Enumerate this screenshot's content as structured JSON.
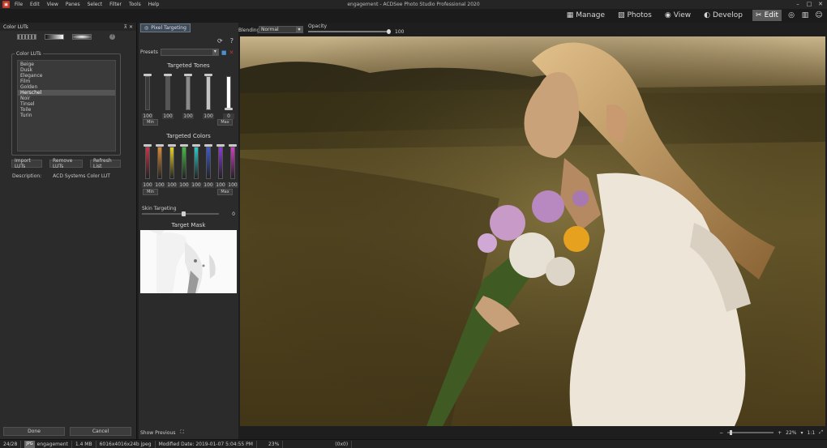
{
  "window": {
    "title": "engagement - ACDSee Photo Studio Professional 2020",
    "menus": [
      "File",
      "Edit",
      "View",
      "Panes",
      "Select",
      "Filter",
      "Tools",
      "Help"
    ]
  },
  "modes": [
    {
      "label": "Manage",
      "icon": "grid-icon"
    },
    {
      "label": "Photos",
      "icon": "photos-icon"
    },
    {
      "label": "View",
      "icon": "eye-icon"
    },
    {
      "label": "Develop",
      "icon": "develop-icon"
    },
    {
      "label": "Edit",
      "icon": "edit-icon",
      "active": true
    }
  ],
  "left_panel": {
    "header": "Color LUTs",
    "group_title": "Color LUTs",
    "luts": [
      "Beige",
      "Dusk",
      "Elegance",
      "Film",
      "Golden",
      "Herschel",
      "Noir",
      "Tinsel",
      "Toile",
      "Turin"
    ],
    "selected_lut": "Herschel",
    "buttons": {
      "import": "Import LUTs",
      "remove": "Remove LUTs",
      "refresh": "Refresh List"
    },
    "description_label": "Description:",
    "description_value": "ACD Systems Color LUT",
    "done": "Done",
    "cancel": "Cancel"
  },
  "mid_panel": {
    "pixel_targeting": "Pixel Targeting",
    "presets_label": "Presets",
    "targeted_tones_title": "Targeted Tones",
    "tones": [
      {
        "value": "100",
        "level": 1.0,
        "color": "#3a3a3a"
      },
      {
        "value": "100",
        "level": 1.0,
        "color": "#555555"
      },
      {
        "value": "100",
        "level": 1.0,
        "color": "#8a8a8a"
      },
      {
        "value": "100",
        "level": 1.0,
        "color": "#c4c4c4"
      },
      {
        "value": "0",
        "level": 0.0,
        "color": "#ffffff"
      }
    ],
    "min_label": "Min",
    "max_label": "Max",
    "targeted_colors_title": "Targeted Colors",
    "colors": [
      {
        "value": "100",
        "color": "#c8344a"
      },
      {
        "value": "100",
        "color": "#e08a2a"
      },
      {
        "value": "100",
        "color": "#e6d12a"
      },
      {
        "value": "100",
        "color": "#3fbf3f"
      },
      {
        "value": "100",
        "color": "#2fc9c9"
      },
      {
        "value": "100",
        "color": "#3a5ad6"
      },
      {
        "value": "100",
        "color": "#8a3ad6"
      },
      {
        "value": "100",
        "color": "#d63ac8"
      }
    ],
    "skin_label": "Skin Targeting",
    "skin_value": "0",
    "skin_level": 0.5,
    "mask_title": "Target Mask",
    "show_previous": "Show Previous"
  },
  "image_toolbar": {
    "blending_label": "Blending:",
    "blending_value": "Normal",
    "opacity_label": "Opacity",
    "opacity_value": "100"
  },
  "zoom": {
    "value": "22%",
    "ratio": "1:1"
  },
  "status": {
    "index": "24/28",
    "type": "JPG",
    "name": "engagement",
    "size": "1.4 MB",
    "dims": "6016x4016x24b jpeg",
    "modified": "Modified Date: 2019-01-07 5:04:55 PM",
    "zoom": "23%",
    "coords": "(0x0)"
  }
}
